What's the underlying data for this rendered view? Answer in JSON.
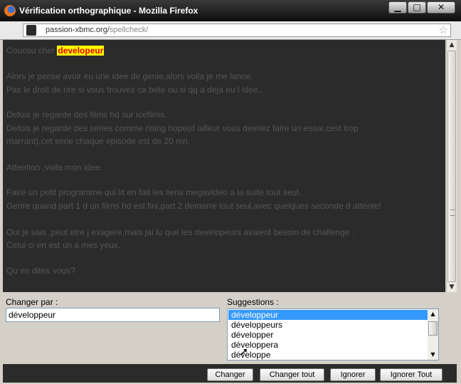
{
  "window": {
    "title": "Vérification orthographique - Mozilla Firefox",
    "controls": {
      "minimize": "▁",
      "maximize": "□",
      "close": "✕"
    }
  },
  "urlbar": {
    "domain": "passion-xbmc.org/",
    "path": "spellcheck/"
  },
  "text": {
    "greeting": "Coucou cher ",
    "misspelled": "developeur",
    "lines": [
      "Alors je pense avoir eu une idee de genie,alors voila je me lance.",
      "Pas le droit de rire si vous trouvez ca bete ou si qq a deja eu l idee..",
      "Defois je regarde des films hd sur icefilms.",
      "Defois je regarde des series comme rising hope(d ailleur vous devriez faire un essai,cest trop",
      "marrant),cet serie chaque episode est de 20 mn.",
      "Attention ,voila mon idee.",
      "Faire un petit programme qui lit en fait les liens megavideo a la suite tout seul.",
      "Genre quand  part 1 d un films hd est fini,part 2 demarre tout seul,avec quelques seconde d attente!",
      "Oui je sais ,peut etre j exagere,mais jai lu que les developeurs avaient besoin de challenge .",
      "Celui ci en est un a mes yeux.",
      "Qu en dites vous?"
    ]
  },
  "change_to": {
    "label": "Changer par :",
    "value": "développeur"
  },
  "suggestions": {
    "label": "Suggestions :",
    "items": [
      "développeur",
      "développeurs",
      "développer",
      "développera",
      "développe"
    ],
    "selected": 0
  },
  "buttons": {
    "change": "Changer",
    "change_all": "Changer tout",
    "ignore": "Ignorer",
    "ignore_all": "Ignorer Tout"
  },
  "colors": {
    "highlight_bg": "#ffff00",
    "highlight_text": "#e00000",
    "selection": "#3399ff"
  }
}
